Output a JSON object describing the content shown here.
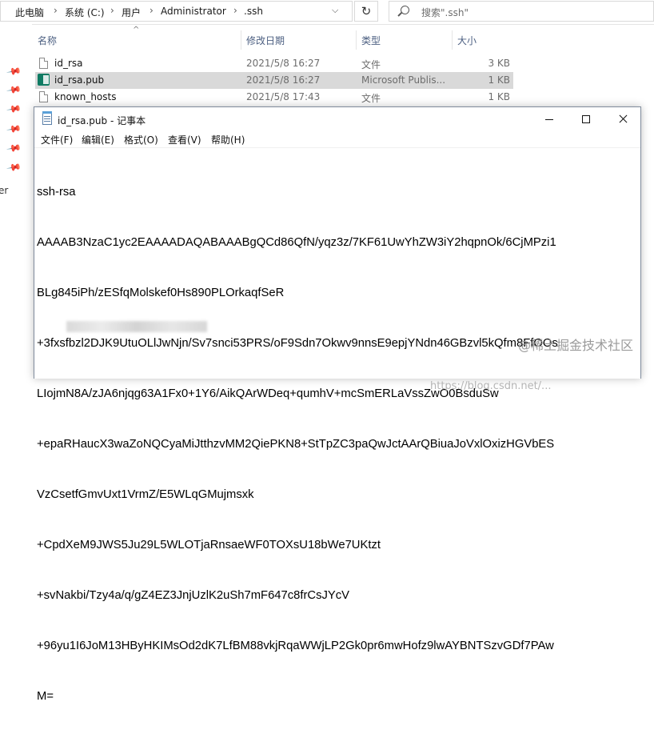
{
  "explorer": {
    "breadcrumb": [
      "此电脑",
      "系统 (C:)",
      "用户",
      "Administrator",
      ".ssh"
    ],
    "search_placeholder": "搜索\".ssh\"",
    "nav_partial_text": "er",
    "columns": {
      "name": "名称",
      "date": "修改日期",
      "type": "类型",
      "size": "大小"
    },
    "files": [
      {
        "name": "id_rsa",
        "date": "2021/5/8 16:27",
        "type": "文件",
        "size": "3 KB",
        "icon": "file-icon",
        "selected": false
      },
      {
        "name": "id_rsa.pub",
        "date": "2021/5/8 16:27",
        "type": "Microsoft Publis...",
        "size": "1 KB",
        "icon": "publisher-icon",
        "selected": true
      },
      {
        "name": "known_hosts",
        "date": "2021/5/8 17:43",
        "type": "文件",
        "size": "1 KB",
        "icon": "file-icon",
        "selected": false
      }
    ]
  },
  "notepad": {
    "title": "id_rsa.pub - 记事本",
    "menu": [
      "文件(F)",
      "编辑(E)",
      "格式(O)",
      "查看(V)",
      "帮助(H)"
    ],
    "content_lines": [
      "ssh-rsa",
      "AAAAB3NzaC1yc2EAAAADAQABAAABgQCd86QfN/yqz3z/7KF61UwYhZW3iY2hqpnOk/6CjMPzi1",
      "BLg845iPh/zESfqMolskef0Hs890PLOrkaqfSeR",
      "+3fxsfbzl2DJK9UtuOLlJwNjn/Sv7snci53PRS/oF9Sdn7Okwv9nnsE9epjYNdn46GBzvl5kQfm8FfOOs",
      "LIojmN8A/zJA6njqg63A1Fx0+1Y6/AikQArWDeq+qumhV+mcSmERLaVssZwO0BsduSw",
      "+epaRHaucX3waZoNQCyaMiJtthzvMM2QiePKN8+StTpZC3paQwJctAArQBiuaJoVxlOxizHGVbES",
      "VzCsetfGmvUxt1VrmZ/E5WLqGMujmsxk",
      "+CpdXeM9JWS5Ju29L5WLOTjaRnsaeWF0TOXsU18bWe7UKtzt",
      "+svNakbi/Tzy4a/q/gZ4EZ3JnjUzlK2uSh7mF647c8frCsJYcV",
      "+96yu1I6JoM13HByHKIMsOd2dK7LfBM88vkjRqaWWjLP2Gk0pr6mwHofz9lwAYBNTSzvGDf7PAw",
      "M="
    ]
  },
  "watermark": "https://blog.csdn.net/...",
  "brand": "@稀土掘金技术社区"
}
